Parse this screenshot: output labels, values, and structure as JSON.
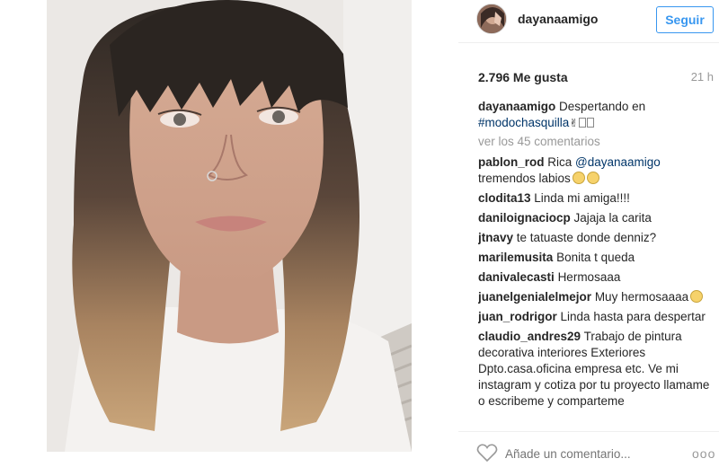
{
  "header": {
    "username": "dayanaamigo",
    "follow_label": "Seguir"
  },
  "stats": {
    "likes": "2.796 Me gusta",
    "time": "21 h"
  },
  "caption": {
    "username": "dayanaamigo",
    "text": "Despertando en",
    "hashtag": "#modochasquilla"
  },
  "view_all": "ver los 45 comentarios",
  "comments": [
    {
      "user": "pablon_rod",
      "text": "Rica ",
      "mention": "@dayanaamigo",
      "text2": " tremendos labios",
      "emoji": 2
    },
    {
      "user": "clodita13",
      "text": "Linda mi amiga!!!!"
    },
    {
      "user": "daniloignaciocp",
      "text": "Jajaja la carita"
    },
    {
      "user": "jtnavy",
      "text": "te tatuaste donde denniz?"
    },
    {
      "user": "marilemusita",
      "text": "Bonita t queda"
    },
    {
      "user": "danivalecasti",
      "text": "Hermosaaa"
    },
    {
      "user": "juanelgenialelmejor",
      "text": "Muy hermosaaaa",
      "emoji": 1
    },
    {
      "user": "juan_rodrigor",
      "text": "Linda hasta para despertar"
    },
    {
      "user": "claudio_andres29",
      "text": "Trabajo de pintura decorativa interiores Exteriores Dpto.casa.oficina empresa etc. Ve mi instagram y cotiza por tu proyecto llamame o escribeme y comparteme"
    }
  ],
  "footer": {
    "add_comment_placeholder": "Añade un comentario...",
    "more": "ooo"
  },
  "icons": {
    "like": "heart-icon",
    "more": "more-options-icon"
  },
  "colors": {
    "follow_blue": "#3897f0",
    "link_blue": "#003569",
    "muted": "#999999"
  }
}
